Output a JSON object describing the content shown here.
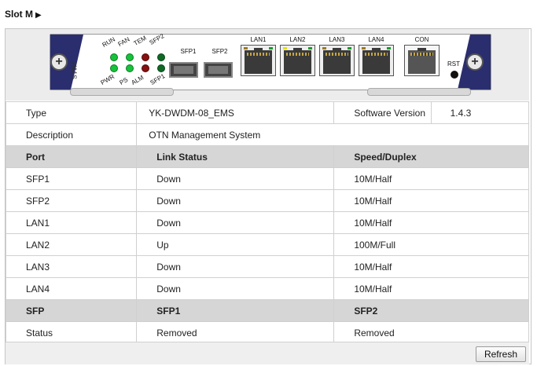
{
  "slot_title": "Slot M",
  "panel": {
    "module_name": "NMS",
    "led_labels": {
      "run": "RUN",
      "fan": "FAN",
      "tem": "TEM",
      "sfp2": "SFP2",
      "pwr": "PWR",
      "ps": "PS",
      "alm": "ALM",
      "sfp1": "SFP1"
    },
    "port_labels": {
      "sfp1": "SFP1",
      "sfp2": "SFP2",
      "lan1": "LAN1",
      "lan2": "LAN2",
      "lan3": "LAN3",
      "lan4": "LAN4",
      "con": "CON",
      "rst": "RST"
    },
    "colors": {
      "led_on": "#16c23a",
      "led_alarm": "#8a1010",
      "panel_blue": "#2a2e6e"
    }
  },
  "info": {
    "type_label": "Type",
    "type_value": "YK-DWDM-08_EMS",
    "sw_label": "Software Version",
    "sw_value": "1.4.3",
    "desc_label": "Description",
    "desc_value": "OTN Management System"
  },
  "ports_header": [
    "Port",
    "Link Status",
    "Speed/Duplex"
  ],
  "ports": [
    {
      "port": "SFP1",
      "status": "Down",
      "speed": "10M/Half"
    },
    {
      "port": "SFP2",
      "status": "Down",
      "speed": "10M/Half"
    },
    {
      "port": "LAN1",
      "status": "Down",
      "speed": "10M/Half"
    },
    {
      "port": "LAN2",
      "status": "Up",
      "speed": "100M/Full"
    },
    {
      "port": "LAN3",
      "status": "Down",
      "speed": "10M/Half"
    },
    {
      "port": "LAN4",
      "status": "Down",
      "speed": "10M/Half"
    }
  ],
  "sfp_header": [
    "SFP",
    "SFP1",
    "SFP2"
  ],
  "sfp_status": {
    "label": "Status",
    "sfp1": "Removed",
    "sfp2": "Removed"
  },
  "refresh_label": "Refresh"
}
